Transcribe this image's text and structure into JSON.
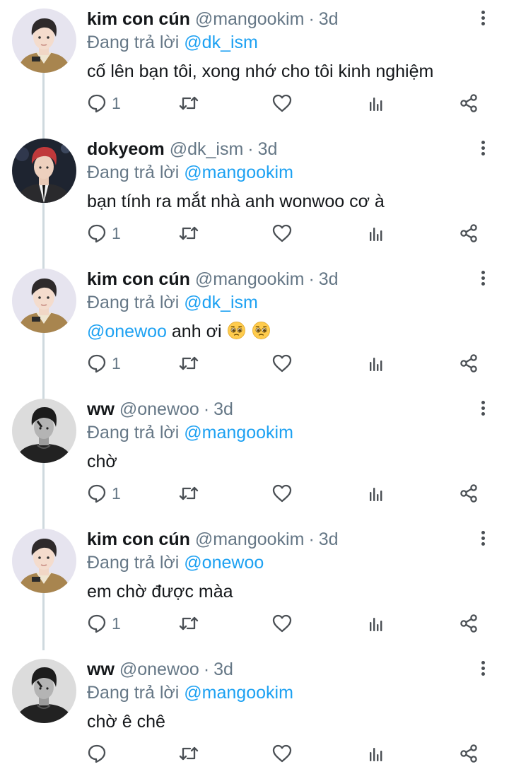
{
  "replying_prefix": "Đang trả lời",
  "dot": "·",
  "colors": {
    "mention": "#1da1f2",
    "secondary": "#657786",
    "text": "#14171a",
    "icon": "#4a4f54"
  },
  "icons": {
    "more": "more-vertical-icon",
    "reply": "reply-bubble-icon",
    "retweet": "retweet-icon",
    "like": "heart-icon",
    "stats": "bar-chart-icon",
    "share": "share-icon"
  },
  "tweets": [
    {
      "name": "kim con cún",
      "handle": "@mangookim",
      "time": "3d",
      "replying_to": "@dk_ism",
      "text": "cố lên bạn tôi, xong nhớ cho tôi kinh nghiệm",
      "mention": "",
      "emoji": [],
      "reply_count": "1",
      "avatar": "brown-hoodie-user"
    },
    {
      "name": "dokyeom",
      "handle": "@dk_ism",
      "time": "3d",
      "replying_to": "@mangookim",
      "text": "bạn tính ra mắt nhà anh wonwoo cơ à",
      "mention": "",
      "emoji": [],
      "reply_count": "1",
      "avatar": "red-hair-suit-user"
    },
    {
      "name": "kim con cún",
      "handle": "@mangookim",
      "time": "3d",
      "replying_to": "@dk_ism",
      "text": "anh ơi",
      "mention": "@onewoo",
      "emoji": [
        "pleading-face-emoji",
        "pleading-face-emoji"
      ],
      "reply_count": "1",
      "avatar": "brown-hoodie-user"
    },
    {
      "name": "ww",
      "handle": "@onewoo",
      "time": "3d",
      "replying_to": "@mangookim",
      "text": "chờ",
      "mention": "",
      "emoji": [],
      "reply_count": "1",
      "avatar": "grayscale-user"
    },
    {
      "name": "kim con cún",
      "handle": "@mangookim",
      "time": "3d",
      "replying_to": "@onewoo",
      "text": "em chờ được màa",
      "mention": "",
      "emoji": [],
      "reply_count": "1",
      "avatar": "brown-hoodie-user"
    },
    {
      "name": "ww",
      "handle": "@onewoo",
      "time": "3d",
      "replying_to": "@mangookim",
      "text": "chờ ê chê",
      "mention": "",
      "emoji": [],
      "reply_count": "",
      "avatar": "grayscale-user"
    }
  ]
}
